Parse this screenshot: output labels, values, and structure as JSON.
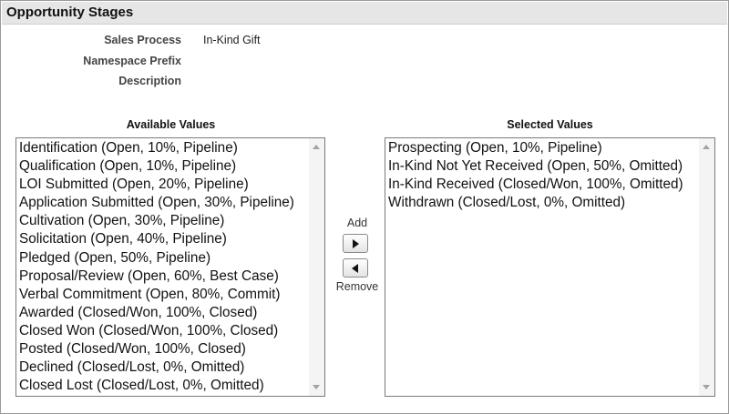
{
  "section": {
    "title": "Opportunity Stages"
  },
  "info": [
    {
      "label": "Sales Process",
      "value": "In-Kind Gift"
    },
    {
      "label": "Namespace Prefix",
      "value": ""
    },
    {
      "label": "Description",
      "value": ""
    }
  ],
  "available": {
    "title": "Available Values",
    "items": [
      "Identification (Open, 10%, Pipeline)",
      "Qualification (Open, 10%, Pipeline)",
      "LOI Submitted (Open, 20%, Pipeline)",
      "Application Submitted (Open, 30%, Pipeline)",
      "Cultivation (Open, 30%, Pipeline)",
      "Solicitation (Open, 40%, Pipeline)",
      "Pledged (Open, 50%, Pipeline)",
      "Proposal/Review (Open, 60%, Best Case)",
      "Verbal Commitment (Open, 80%, Commit)",
      "Awarded (Closed/Won, 100%, Closed)",
      "Closed Won (Closed/Won, 100%, Closed)",
      "Posted (Closed/Won, 100%, Closed)",
      "Declined (Closed/Lost, 0%, Omitted)",
      "Closed Lost (Closed/Lost, 0%, Omitted)"
    ]
  },
  "selected": {
    "title": "Selected Values",
    "items": [
      "Prospecting (Open, 10%, Pipeline)",
      "In-Kind Not Yet Received (Open, 50%, Omitted)",
      "In-Kind Received (Closed/Won, 100%, Omitted)",
      "Withdrawn (Closed/Lost, 0%, Omitted)"
    ]
  },
  "controls": {
    "add_label": "Add",
    "remove_label": "Remove"
  },
  "icons": {
    "add": "arrow-right-icon",
    "remove": "arrow-left-icon",
    "scroll_up": "scroll-up-icon",
    "scroll_down": "scroll-down-icon"
  },
  "colors": {
    "header_bg": "#e6e6e6",
    "border": "#7a7a7a"
  }
}
